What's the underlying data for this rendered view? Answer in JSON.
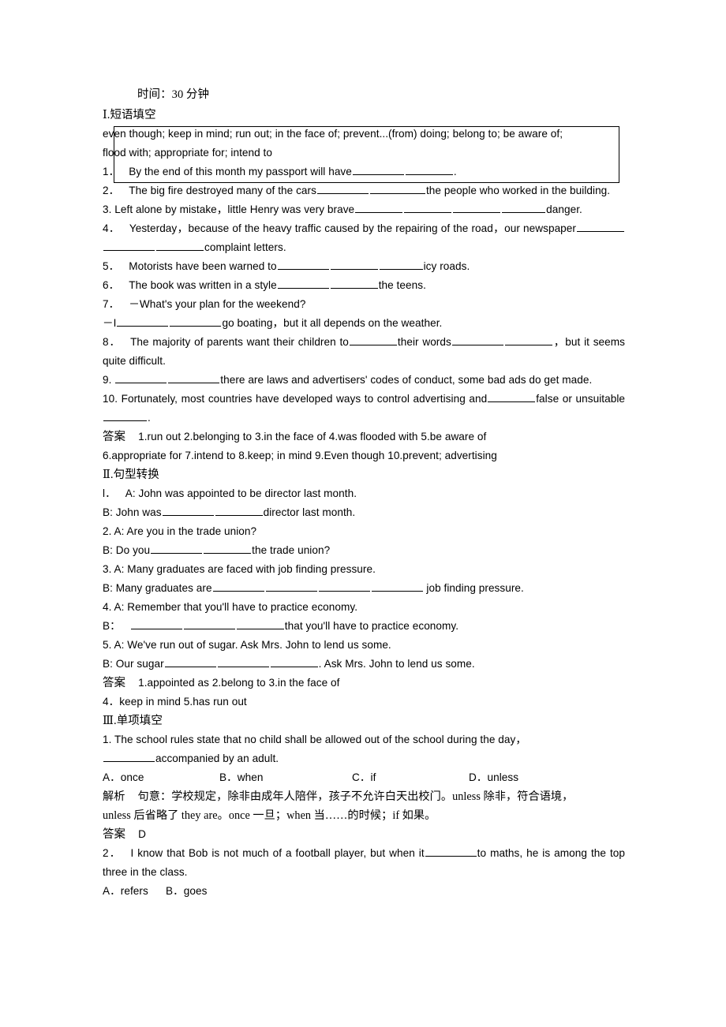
{
  "document": {
    "time_label": "时间：30 分钟",
    "sections": [
      {
        "heading": "Ⅰ.短语填空",
        "phrase_box": {
          "line1": "even though; keep in mind; run out; in the face of; prevent...(from) doing; belong to; be aware of;",
          "line2": "flood with; appropriate for; intend to"
        },
        "items": [
          {
            "num": "1．",
            "a": "By the end of this month my passport will have",
            "b": "",
            "c": "."
          },
          {
            "num": "2．",
            "a": "The big fire destroyed many of the cars",
            "b": "",
            "c": "the people who worked in the building."
          },
          {
            "num": "3.",
            "a": "Left alone by mistake，little Henry was very brave",
            "b": "",
            "c": "danger."
          },
          {
            "num": "4．",
            "a": "Yesterday，because of the heavy traffic caused by the repairing of the road，our newspaper",
            "b": "",
            "c": "complaint letters."
          },
          {
            "num": "5．",
            "a": "Motorists have been warned to",
            "b": "",
            "c": "icy roads."
          },
          {
            "num": "6．",
            "a": "The book was written in a style",
            "b": "",
            "c": "the teens."
          },
          {
            "num": "7．",
            "a": "－What's your plan for the weekend?",
            "b": "",
            "c": ""
          },
          {
            "num": "",
            "a": "－I",
            "b": "",
            "c": "go boating，but it all depends on the weather."
          },
          {
            "num": "8．",
            "a": "The majority of parents want their children to",
            "b": "their words",
            "c": "，but it seems quite difficult."
          },
          {
            "num": "9.",
            "a": "",
            "b": "",
            "c": "there are laws and advertisers' codes of conduct, some bad ads do get made."
          },
          {
            "num": "10.",
            "a": "Fortunately, most countries have developed ways to control advertising and",
            "b": "false or unsuitable",
            "c": "."
          }
        ],
        "answer_label": "答案",
        "answers_line1": "1.run out    2.belonging to    3.in the face of    4.was flooded with    5.be aware of",
        "answers_line2": "6.appropriate for   7.intend to   8.keep; in mind   9.Even though   10.prevent; advertising"
      },
      {
        "heading": "Ⅱ.句型转换",
        "items": [
          {
            "num": "l．",
            "text": "A: John was appointed to be director last month."
          },
          {
            "num": "",
            "text": "B: John was"
          },
          {
            "num": "",
            "text": "director last month."
          },
          {
            "num": "2.",
            "text": "A: Are you in the trade union?"
          },
          {
            "num": "",
            "text": "B: Do you"
          },
          {
            "num": "",
            "text": "the trade union?"
          },
          {
            "num": "3.",
            "text": "A: Many graduates are faced with job finding pressure."
          },
          {
            "num": "",
            "text": "B: Many graduates are"
          },
          {
            "num": "",
            "text": "job finding pressure."
          },
          {
            "num": "4.",
            "text": "A: Remember that you'll have to practice economy."
          },
          {
            "num": "",
            "text": "B："
          },
          {
            "num": "",
            "text": "that you'll have to practice economy."
          },
          {
            "num": "5.",
            "text": "A: We've run out of sugar. Ask Mrs. John to lend us some."
          },
          {
            "num": "",
            "text": "B: Our sugar"
          },
          {
            "num": "",
            "text": ". Ask Mrs. John to lend us some."
          }
        ],
        "answer_label": "答案",
        "answers_line1": "1.appointed as   2.belong to   3.in the face of",
        "answers_line2": "4．keep in mind   5.has run out"
      },
      {
        "heading": "Ⅲ.单项填空",
        "q1": {
          "num": "1.",
          "stem_a": "The school rules state that no child shall be allowed out of the school during the day，",
          "stem_b": "accompanied by an adult.",
          "options": [
            {
              "key": "A．",
              "val": "once"
            },
            {
              "key": "B．",
              "val": "when"
            },
            {
              "key": "C．",
              "val": "if"
            },
            {
              "key": "D．",
              "val": "unless"
            }
          ],
          "analysis_label": "解析",
          "analysis_line1": "句意：学校规定，除非由成年人陪伴，孩子不允许白天出校门。unless 除非，符合语境，",
          "analysis_line2": "unless 后省略了 they are。once 一旦；when 当……的时候；if 如果。",
          "answer_label": "答案",
          "answer_value": "D"
        },
        "q2": {
          "num": "2．",
          "stem_a": "I know that Bob is not much of a football player, but when it",
          "stem_b": "to maths, he is among the top three in the class.",
          "options": [
            {
              "key": "A．",
              "val": "refers"
            },
            {
              "key": "B．",
              "val": "goes"
            }
          ]
        }
      }
    ]
  }
}
